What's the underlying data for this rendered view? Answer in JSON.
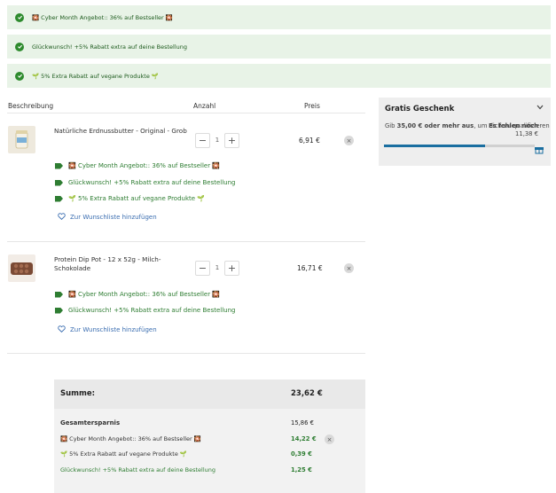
{
  "banners": [
    {
      "text": "🎇 Cyber Month Angebot:: 36% auf Bestseller 🎇"
    },
    {
      "text": "Glückwunsch! +5% Rabatt extra auf deine Bestellung"
    },
    {
      "text": "🌱 5% Extra Rabatt auf vegane Produkte 🌱"
    }
  ],
  "table": {
    "col_description": "Beschreibung",
    "col_quantity": "Anzahl",
    "col_price": "Preis"
  },
  "items": [
    {
      "name": "Natürliche Erdnussbutter - Original - Grob",
      "quantity": "1",
      "price": "6,91 €",
      "promos": [
        "🎇 Cyber Month Angebot:: 36% auf Bestseller 🎇",
        "Glückwunsch! +5% Rabatt extra auf deine Bestellung",
        "🌱 5% Extra Rabatt auf vegane Produkte 🌱"
      ],
      "wishlist": "Zur Wunschliste hinzufügen"
    },
    {
      "name": "Protein Dip Pot - 12 x 52g - Milch-Schokolade",
      "quantity": "1",
      "price": "16,71 €",
      "promos": [
        "🎇 Cyber Month Angebot:: 36% auf Bestseller 🎇",
        "Glückwunsch! +5% Rabatt extra auf deine Bestellung"
      ],
      "wishlist": "Zur Wunschliste hinzufügen"
    }
  ],
  "qty_controls": {
    "minus": "−",
    "plus": "+"
  },
  "gift": {
    "title": "Gratis Geschenk",
    "text_prefix": "Gib ",
    "text_amount": "35,00 € oder mehr aus",
    "text_suffix": ", um dich zu qualifizieren",
    "left_label": "Es fehlen noch",
    "left_value": "11,38 €",
    "progress": 0.67
  },
  "summary": {
    "total_label": "Summe:",
    "total_value": "23,62 €",
    "savings_label": "Gesamtersparnis",
    "savings_value": "15,86 €",
    "discounts": [
      {
        "label": "🎇 Cyber Month Angebot:: 36% auf Bestseller 🎇",
        "value": "14,22 €"
      },
      {
        "label": "🌱 5% Extra Rabatt auf vegane Produkte 🌱",
        "value": "0,39 €"
      },
      {
        "label": "Glückwunsch! +5% Rabatt extra auf deine Bestellung",
        "value": "1,25 €"
      }
    ]
  },
  "colors": {
    "banner_bg": "#e8f3e7",
    "promo_green": "#2e7d32",
    "link_blue": "#3a6db0",
    "progress_blue": "#1a6ea0"
  }
}
